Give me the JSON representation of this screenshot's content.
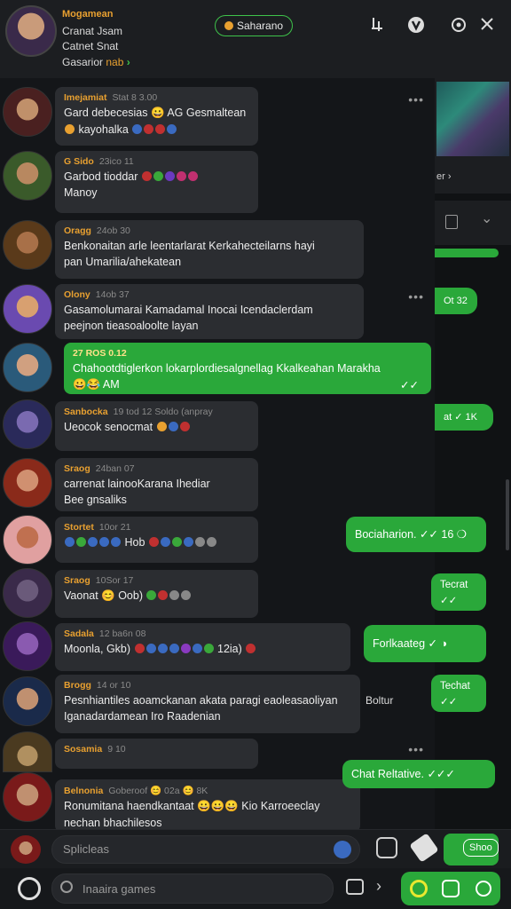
{
  "header": {
    "name": "Mogamean",
    "line1": "Cranat Jsam",
    "line2": "Catnet Snat",
    "line3_prefix": "Gasarior",
    "line3_status": "nab",
    "line3_chev": "›",
    "chip_label": "Saharano"
  },
  "messages": [
    {
      "name": "Imejamiat",
      "time": "Stat 8 3.00",
      "lines": [
        "Gard debecesias 😀 AG Gesmaltean",
        "kayohalka"
      ]
    },
    {
      "name": "G Sido",
      "time": "23ico 11",
      "lines": [
        "Garbod tioddar",
        "Manoy"
      ]
    },
    {
      "name": "Oragg",
      "time": "24ob 30",
      "lines": [
        "Benkonaitan arle leentarlarat Kerkahecteilarns hayi",
        "pan Umarilia/ahekatean"
      ]
    },
    {
      "name": "Olony",
      "time": "14ob 37",
      "lines": [
        "Gasamolumarai Kamadamal Inocai Icendaclerdam",
        "peejnon tieasoaloolte layan"
      ]
    },
    {
      "name": "27 ROS 0.12",
      "time": "",
      "lines": [
        "Chahootdtiglerkon lokarplordiesalgnellag Kkalkeahan Marakha",
        "😀😂 AM"
      ],
      "check": "✓✓"
    },
    {
      "name": "Sanbocka",
      "time": "19 tod 12 Soldo (anpray",
      "lines": [
        "Ueocok senocmat"
      ]
    },
    {
      "name": "Sraog",
      "time": "24ban 07",
      "lines": [
        "carrenat lainooKarana Ihediar",
        "Bee gnsaliks"
      ]
    },
    {
      "name": "Stortet",
      "time": "10or 21",
      "lines": [
        "Hob"
      ]
    },
    {
      "name": "Sraog",
      "time": "10Sor 17",
      "lines": [
        "Vaonat 😊 Oob)"
      ]
    },
    {
      "name": "Sadala",
      "time": "12 ba6n 08",
      "lines": [
        "Moonla, Gkb)",
        "12ia)"
      ]
    },
    {
      "name": "Brogg",
      "time": "14 or 10",
      "lines": [
        "Pesnhiantiles aoamckanan akata paragi eaoleasaoliyan",
        "Iganadardamean Iro Raadenian"
      ],
      "side": "Boltur"
    },
    {
      "name": "Sosamia",
      "time": "9 10",
      "lines": []
    },
    {
      "name": "Belnonia",
      "time": "Goberoof 😊 02a 😊 8K",
      "lines": [
        "Ronumitana haendkantaat 😀😀😀 Kio Karroeeclay",
        "nechan bhachilesos"
      ]
    }
  ],
  "right_bubbles": [
    {
      "text": "Bociaharion. ✓✓ 16 ❍"
    },
    {
      "text": "Tecrat ✓✓"
    },
    {
      "text": "Forlkaateg ✓ ◑"
    },
    {
      "text": "Techat ✓✓"
    },
    {
      "text": "Chat Reltative. ✓✓✓"
    }
  ],
  "side": {
    "card_text": "er ›",
    "b1": "Ot 32",
    "b2": "at ✓ 1K"
  },
  "input": {
    "placeholder": "Splicleas",
    "send_label": "Shoo"
  },
  "search": {
    "placeholder": "Inaaira games"
  }
}
